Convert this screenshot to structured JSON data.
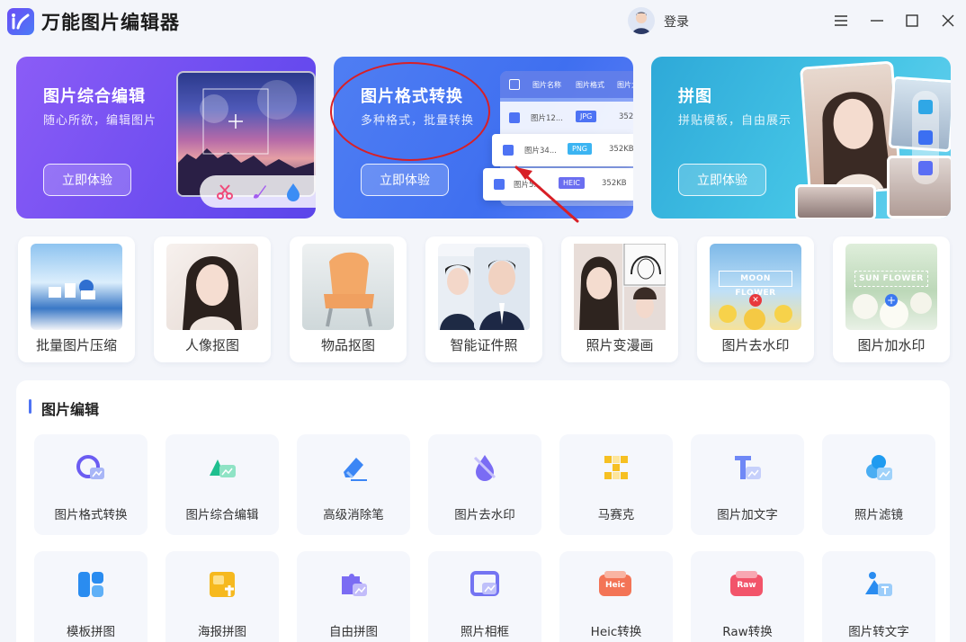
{
  "app": {
    "title": "万能图片编辑器",
    "login_label": "登录"
  },
  "hero": [
    {
      "title": "图片综合编辑",
      "subtitle": "随心所欲，编辑图片",
      "button": "立即体验"
    },
    {
      "title": "图片格式转换",
      "subtitle": "多种格式，批量转换",
      "button": "立即体验",
      "preview": {
        "headers": [
          "图片名称",
          "图片格式",
          "图片大小"
        ],
        "rows": [
          {
            "name": "图片12...",
            "format": "JPG",
            "size": "352"
          },
          {
            "name": "图片34...",
            "format": "PNG",
            "size": "352KB"
          },
          {
            "name": "图片5...",
            "format": "HEIC",
            "size": "352KB"
          }
        ]
      }
    },
    {
      "title": "拼图",
      "subtitle": "拼贴模板，自由展示",
      "button": "立即体验"
    }
  ],
  "tools": [
    {
      "label": "批量图片压缩"
    },
    {
      "label": "人像抠图"
    },
    {
      "label": "物品抠图"
    },
    {
      "label": "智能证件照"
    },
    {
      "label": "照片变漫画"
    },
    {
      "label": "图片去水印",
      "overlay": "MOON FLOWER"
    },
    {
      "label": "图片加水印",
      "overlay": "SUN FLOWER"
    }
  ],
  "edit_section": {
    "title": "图片编辑",
    "row1": [
      "图片格式转换",
      "图片综合编辑",
      "高级消除笔",
      "图片去水印",
      "马赛克",
      "图片加文字",
      "照片滤镜"
    ],
    "row2": [
      "模板拼图",
      "海报拼图",
      "自由拼图",
      "照片相框",
      "Heic转换",
      "Raw转换",
      "图片转文字"
    ],
    "icon_badges": {
      "heic": "Heic",
      "raw": "Raw"
    }
  },
  "colors": {
    "accent": "#4e73f4",
    "annotation": "#d81f26"
  }
}
